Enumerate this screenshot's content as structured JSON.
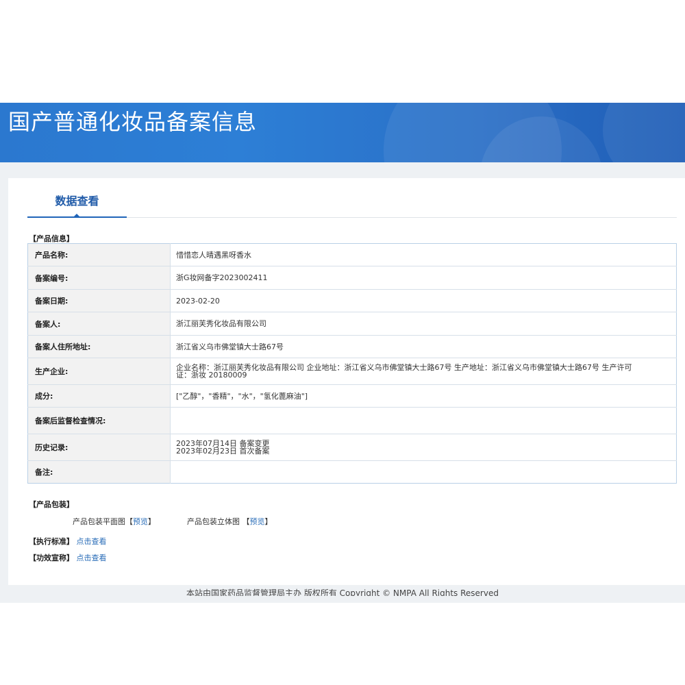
{
  "banner": {
    "title": "国产普通化妆品备案信息"
  },
  "tabs": [
    {
      "label": "数据查看",
      "active": true
    }
  ],
  "product_info": {
    "section_title": "【产品信息】",
    "rows": [
      {
        "label": "产品名称:",
        "lines": [
          "惜惜恋人晴遇黑呀香水"
        ]
      },
      {
        "label": "备案编号:",
        "lines": [
          "浙G妆网备字2023002411"
        ]
      },
      {
        "label": "备案日期:",
        "lines": [
          "2023-02-20"
        ]
      },
      {
        "label": "备案人:",
        "lines": [
          "浙江丽芙秀化妆品有限公司"
        ]
      },
      {
        "label": "备案人住所地址:",
        "lines": [
          "浙江省义乌市佛堂镇大士路67号"
        ]
      },
      {
        "label": "生产企业:",
        "lines": [
          "企业名称：浙江丽芙秀化妆品有限公司 企业地址：浙江省义乌市佛堂镇大士路67号 生产地址：浙江省义乌市佛堂镇大士路67号 生产许可",
          "证：浙妆 20180009"
        ]
      },
      {
        "label": "成分:",
        "lines": [
          "[\"乙醇\"，\"香精\"，\"水\"，\"氢化蓖麻油\"]"
        ]
      },
      {
        "label": "备案后监督检查情况:",
        "lines": []
      },
      {
        "label": "历史记录:",
        "lines": [
          "2023年07月14日 备案变更",
          "2023年02月23日 首次备案"
        ]
      },
      {
        "label": "备注:",
        "lines": []
      }
    ]
  },
  "packaging": {
    "section_title": "【产品包装】",
    "flat_label": "产品包装平面图",
    "flat_link": "预览",
    "solid_label": "产品包装立体图",
    "solid_link": "预览",
    "bracket_open": "【",
    "bracket_close": "】"
  },
  "standard": {
    "label": "【执行标准】",
    "link": "点击查看"
  },
  "efficacy": {
    "label": "【功效宣称】",
    "link": "点击查看"
  },
  "footer": {
    "text": "本站由国家药品监督管理局主办 版权所有 Copyright © NMPA All Rights Reserved"
  },
  "colors": {
    "banner": "#2b78cf",
    "accent": "#1f5aa8",
    "link": "#2a6db8",
    "page_bg": "#eef1f4"
  }
}
